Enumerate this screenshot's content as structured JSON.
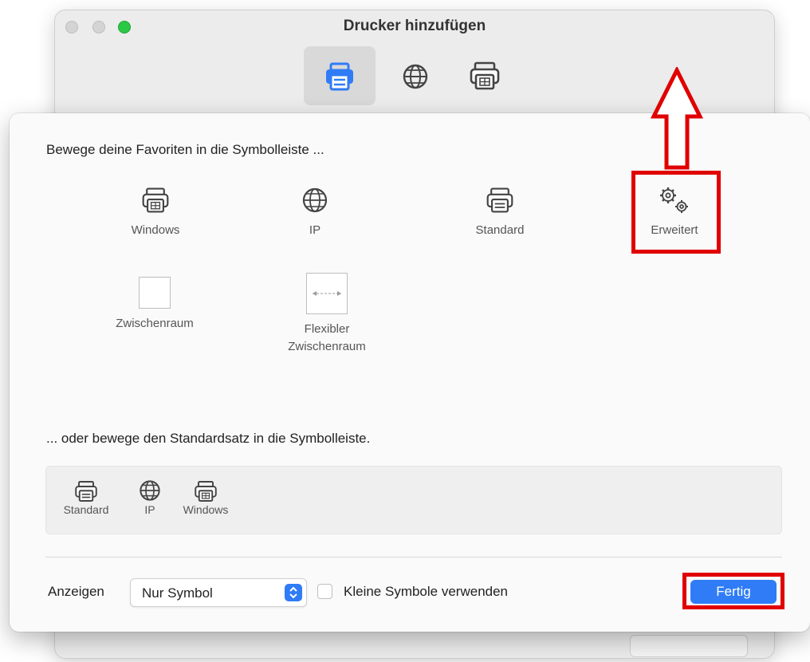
{
  "window": {
    "title": "Drucker hinzufügen",
    "toolbar_icons": [
      "default-printer-icon",
      "ip-globe-icon",
      "windows-printer-icon"
    ]
  },
  "sheet": {
    "instruction_favorites": "Bewege deine Favoriten in die Symbolleiste ...",
    "items": [
      {
        "label": "Windows",
        "icon": "windows-printer-icon"
      },
      {
        "label": "IP",
        "icon": "globe-icon"
      },
      {
        "label": "Standard",
        "icon": "printer-icon"
      },
      {
        "label": "Erweitert",
        "icon": "gears-icon"
      },
      {
        "label": "Zwischenraum",
        "icon": "space-icon"
      },
      {
        "label": "Flexibler Zwischenraum",
        "label_line1": "Flexibler",
        "label_line2": "Zwischenraum",
        "icon": "flexible-space-icon"
      }
    ],
    "instruction_default": "... oder bewege den Standardsatz in die Symbolleiste.",
    "default_set": [
      "Standard",
      "IP",
      "Windows"
    ],
    "show_label": "Anzeigen",
    "show_select_value": "Nur Symbol",
    "small_icons_label": "Kleine Symbole verwenden",
    "small_icons_checked": false,
    "done_label": "Fertig"
  },
  "colors": {
    "accent": "#2f7cf6",
    "annotation": "#e00000",
    "traffic_green": "#2ac845"
  }
}
